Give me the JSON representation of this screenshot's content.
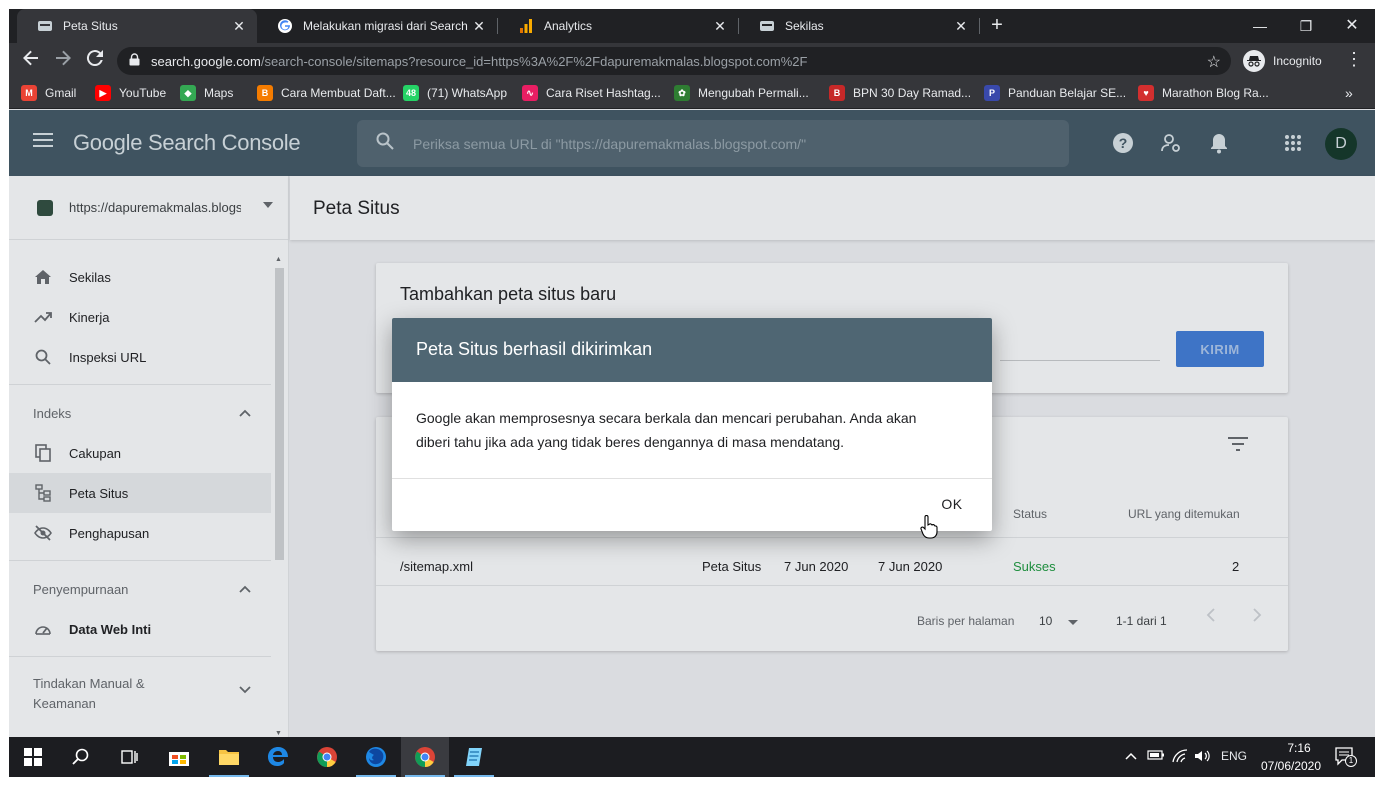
{
  "browser": {
    "tabs": [
      {
        "title": "Peta Situs",
        "active": true
      },
      {
        "title": "Melakukan migrasi dari Search C",
        "active": false
      },
      {
        "title": "Analytics",
        "active": false
      },
      {
        "title": "Sekilas",
        "active": false
      }
    ],
    "url_host": "search.google.com",
    "url_rest": "/search-console/sitemaps?resource_id=https%3A%2F%2Fdapuremakmalas.blogspot.com%2F",
    "incognito_label": "Incognito",
    "bookmarks": [
      {
        "label": "Gmail",
        "color": "#ea4335",
        "glyph": "M"
      },
      {
        "label": "YouTube",
        "color": "#ff0000",
        "glyph": "▶"
      },
      {
        "label": "Maps",
        "color": "#34a853",
        "glyph": "◆"
      },
      {
        "label": "Cara Membuat Daft...",
        "color": "#f57c00",
        "glyph": "B"
      },
      {
        "label": "(71) WhatsApp",
        "color": "#25d366",
        "glyph": "48"
      },
      {
        "label": "Cara Riset Hashtag...",
        "color": "#e91e63",
        "glyph": "∿"
      },
      {
        "label": "Mengubah Permali...",
        "color": "#2e7d32",
        "glyph": "✿"
      },
      {
        "label": "BPN 30 Day Ramad...",
        "color": "#c62828",
        "glyph": "B"
      },
      {
        "label": "Panduan Belajar SE...",
        "color": "#3949ab",
        "glyph": "P"
      },
      {
        "label": "Marathon Blog Ra...",
        "color": "#d32f2f",
        "glyph": "♥"
      }
    ]
  },
  "gsc": {
    "brand": "Google Search Console",
    "search_placeholder": "Periksa semua URL di \"https://dapuremakmalas.blogspot.com/\"",
    "avatar_letter": "D",
    "property_url": "https://dapuremakmalas.blogspot.com/",
    "nav": {
      "sekilas": "Sekilas",
      "kinerja": "Kinerja",
      "inspeksi": "Inspeksi URL",
      "indeks_section": "Indeks",
      "cakupan": "Cakupan",
      "peta_situs": "Peta Situs",
      "penghapusan": "Penghapusan",
      "penyempurnaan_section": "Penyempurnaan",
      "data_web_inti": "Data Web Inti",
      "tindakan_section_line1": "Tindakan Manual &",
      "tindakan_section_line2": "Keamanan"
    },
    "page_title": "Peta Situs",
    "add_card": {
      "title": "Tambahkan peta situs baru",
      "submit_label": "KIRIM"
    },
    "table": {
      "headers": {
        "status": "Status",
        "urls": "URL yang ditemukan"
      },
      "row": {
        "sitemap": "/sitemap.xml",
        "type": "Peta Situs",
        "submitted": "7 Jun 2020",
        "read": "7 Jun 2020",
        "status": "Sukses",
        "urls": "2"
      },
      "rows_per_page_label": "Baris per halaman",
      "rows_per_page_value": "10",
      "range": "1-1 dari 1"
    },
    "dialog": {
      "title": "Peta Situs berhasil dikirimkan",
      "body_line1": "Google akan memprosesnya secara berkala dan mencari perubahan. Anda akan",
      "body_line2": "diberi tahu jika ada yang tidak beres dengannya di masa mendatang.",
      "ok_label": "OK"
    }
  },
  "taskbar": {
    "lang": "ENG",
    "time": "7:16",
    "date": "07/06/2020",
    "notification_count": "1"
  },
  "colors": {
    "gsc_header": "#3f5360",
    "status_success": "#1e8e3e",
    "submit_button": "#3e74c6"
  }
}
